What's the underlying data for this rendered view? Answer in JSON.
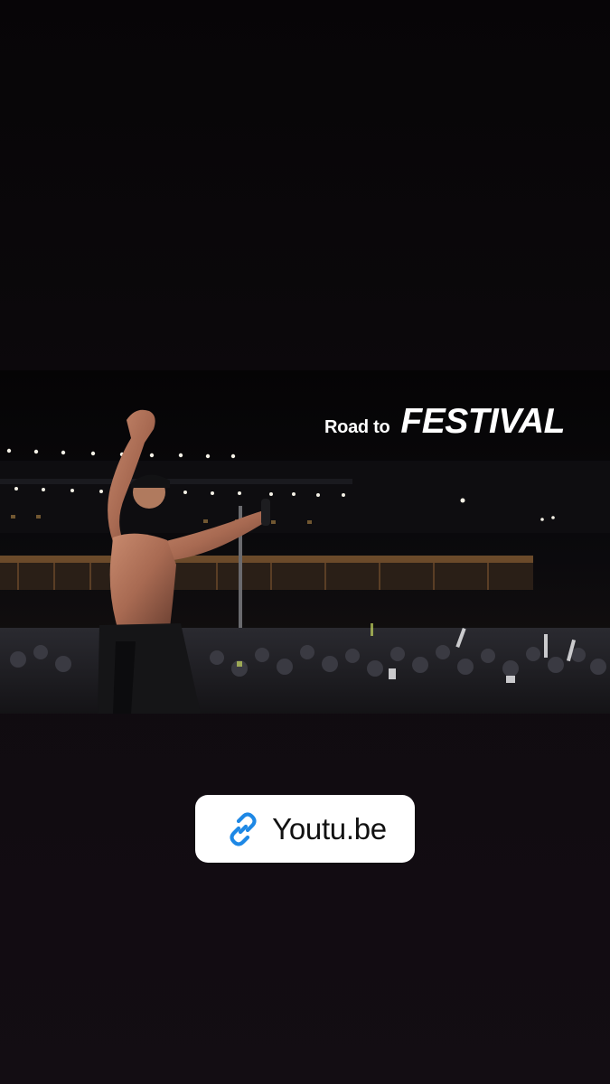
{
  "story": {
    "background_color": "#120c12"
  },
  "media": {
    "title_small": "Road to",
    "title_big": "FESTIVAL"
  },
  "link_sticker": {
    "icon": "link-icon",
    "icon_color": "#1e88e5",
    "label": "Youtu.be"
  }
}
